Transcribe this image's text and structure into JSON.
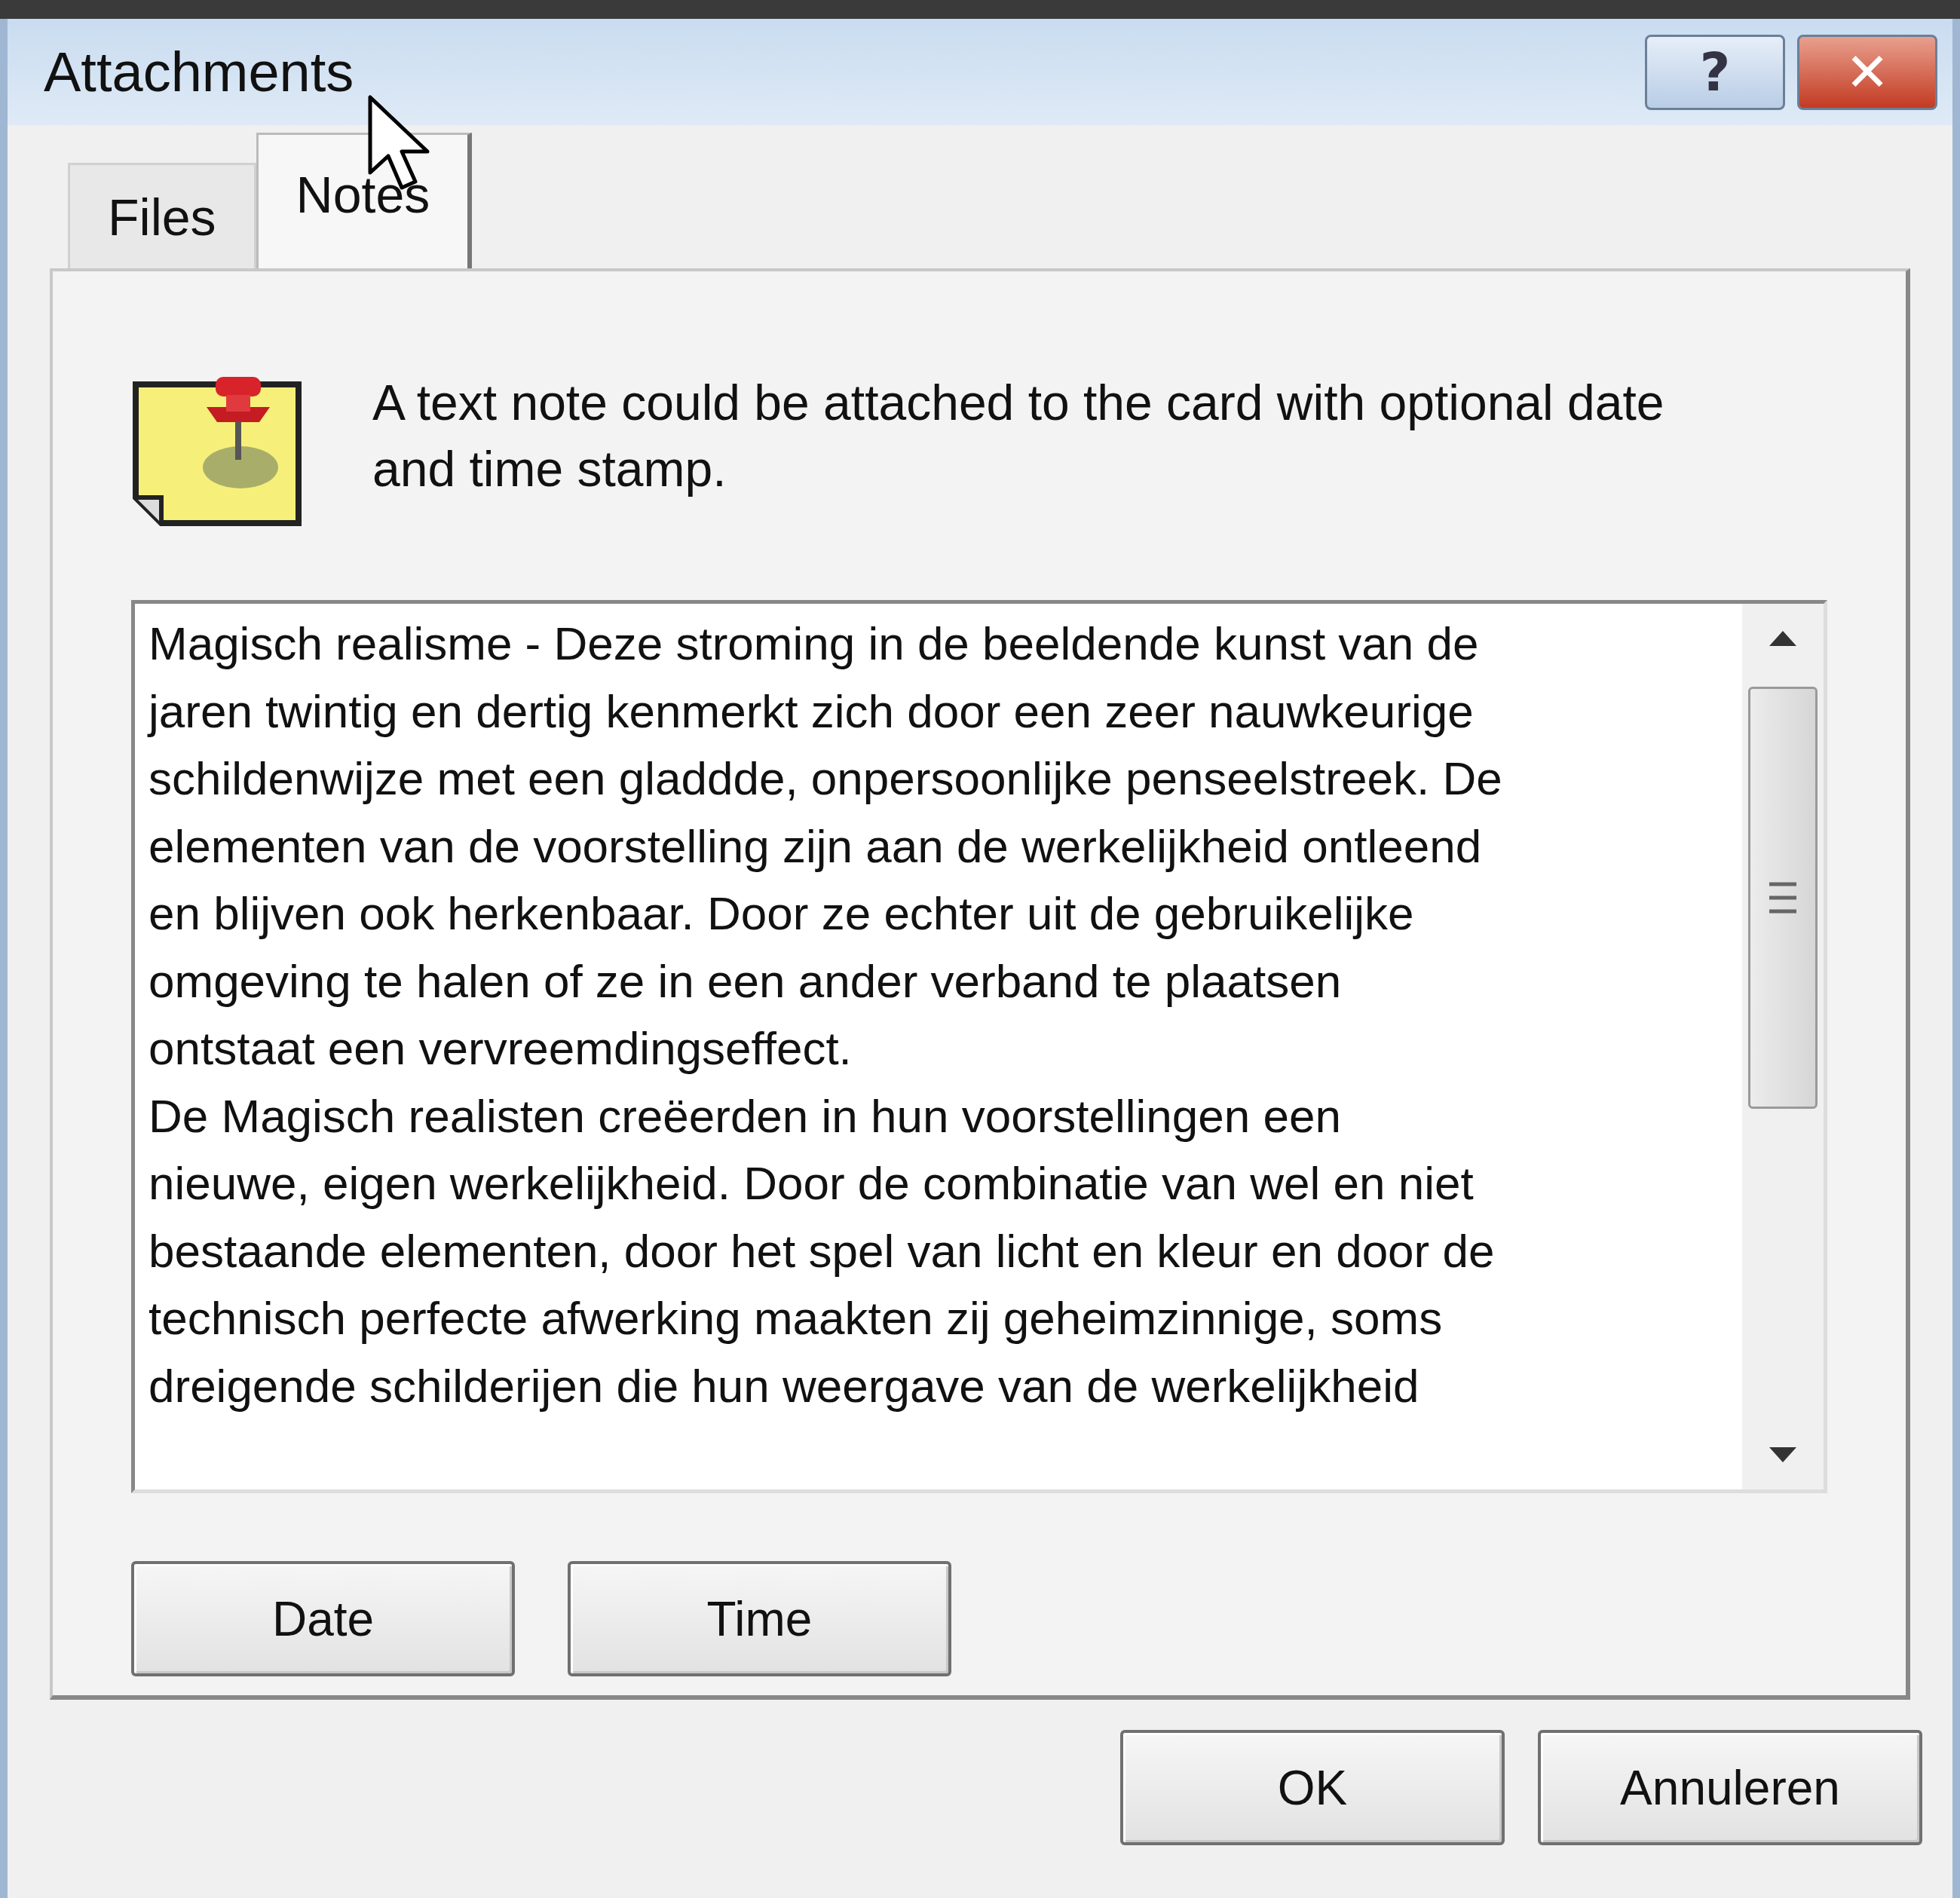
{
  "window": {
    "title": "Attachments",
    "help_button": "?",
    "close_button": "✕"
  },
  "tabs": [
    {
      "label": "Files",
      "selected": false
    },
    {
      "label": "Notes",
      "selected": true
    }
  ],
  "description": "A text note could be attached to the card with optional date and time stamp.",
  "note_lines": [
    "Magisch realisme - Deze stroming in de beeldende kunst van de",
    "jaren twintig en dertig kenmerkt zich door een zeer nauwkeurige",
    "schildenwijze met een gladdde, onpersoonlijke penseelstreek. De",
    "elementen van de voorstelling zijn aan de werkelijkheid ontleend",
    "en blijven ook herkenbaar. Door ze echter uit de gebruikelijke",
    "omgeving te halen of ze in een ander verband te plaatsen",
    "ontstaat een vervreemdingseffect.",
    "De Magisch realisten creëerden in hun voorstellingen een",
    "nieuwe, eigen werkelijkheid. Door de combinatie van wel en niet",
    "bestaande elementen, door het spel van licht en kleur en door de",
    "technisch perfecte afwerking maakten zij geheimzinnige, soms",
    "dreigende schilderijen die hun weergave van de werkelijkheid"
  ],
  "stamp_buttons": [
    "Date",
    "Time"
  ],
  "buttons": [
    "OK",
    "Annuleren"
  ]
}
